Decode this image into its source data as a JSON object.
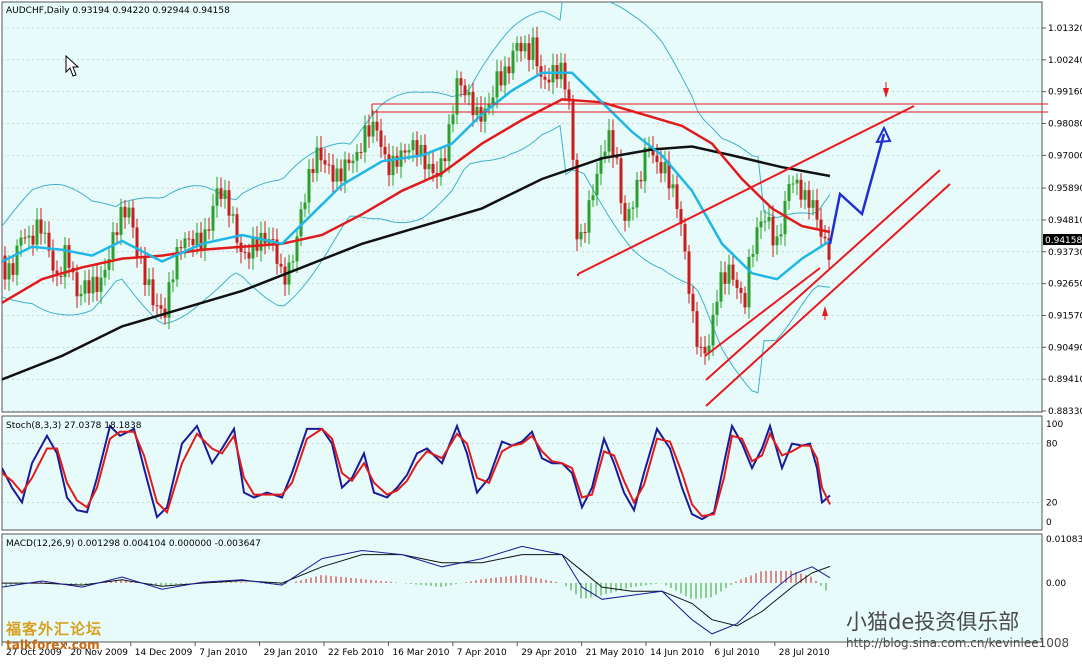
{
  "colors": {
    "panel_bg": "#e8fbfb",
    "grid": "#b0bcbc",
    "bull": "#2ca02c",
    "bear": "#c81e1e",
    "ma_fast": "#1fb7e6",
    "ma_mid": "#e01b1b",
    "ma_slow": "#111111",
    "bollinger": "#3fb2c8",
    "trend": "#e8191f",
    "projection": "#1f2fd0",
    "stoch_main": "#1a1a9a",
    "stoch_signal": "#e01b1b",
    "macd_main": "#1a1a9a",
    "macd_signal": "#111111"
  },
  "header": {
    "title": "AUDCHF,Daily  0.93194 0.94220 0.92944 0.94158"
  },
  "price_axis": {
    "ticks": [
      "1.01320",
      "1.00240",
      "0.99160",
      "0.98080",
      "0.97000",
      "0.95890",
      "0.94810",
      "0.93730",
      "0.92650",
      "0.91570",
      "0.90490",
      "0.89410",
      "0.88330"
    ],
    "current": "0.94158"
  },
  "stoch_panel": {
    "label": "Stoch(8,3,3) 27.0378 18.1838",
    "ticks": [
      "100",
      "80",
      "20",
      "0"
    ]
  },
  "macd_panel": {
    "label": "MACD(12,26,9) 0.001298 0.004104 0.000000 -0.003647",
    "ticks": [
      "0.01083",
      "0.00"
    ]
  },
  "date_axis": {
    "ticks": [
      "27 Oct 2009",
      "20 Nov 2009",
      "14 Dec 2009",
      "7 Jan 2010",
      "29 Jan 2010",
      "22 Feb 2010",
      "16 Mar 2010",
      "7 Apr 2010",
      "29 Apr 2010",
      "21 May 2010",
      "14 Jun 2010",
      "6 Jul 2010",
      "28 Jul 2010"
    ]
  },
  "watermarks": {
    "site_cn": "福客外汇论坛",
    "site_en": "talkforex.com",
    "club_cn": "小猫de投资俱乐部",
    "blog_url": "http://blog.sina.com.cn/kevinlee1008"
  },
  "chart_data": {
    "type": "candlestick",
    "symbol": "AUDCHF",
    "timeframe": "Daily",
    "last_ohlc": {
      "open": 0.93194,
      "high": 0.9422,
      "low": 0.92944,
      "close": 0.94158
    },
    "ylim": [
      0.8833,
      1.0132
    ],
    "close_path": [
      [
        0,
        0.936
      ],
      [
        10,
        0.932
      ],
      [
        20,
        0.94
      ],
      [
        28,
        0.936
      ],
      [
        38,
        0.948
      ],
      [
        46,
        0.944
      ],
      [
        55,
        0.93
      ],
      [
        64,
        0.936
      ],
      [
        75,
        0.918
      ],
      [
        88,
        0.928
      ],
      [
        100,
        0.932
      ],
      [
        110,
        0.94
      ],
      [
        120,
        0.946
      ],
      [
        128,
        0.948
      ],
      [
        135,
        0.938
      ],
      [
        145,
        0.932
      ],
      [
        155,
        0.92
      ],
      [
        163,
        0.914
      ],
      [
        172,
        0.928
      ],
      [
        180,
        0.94
      ],
      [
        192,
        0.946
      ],
      [
        205,
        0.944
      ],
      [
        215,
        0.954
      ],
      [
        228,
        0.95
      ],
      [
        240,
        0.94
      ],
      [
        252,
        0.942
      ],
      [
        262,
        0.938
      ],
      [
        272,
        0.936
      ],
      [
        280,
        0.928
      ],
      [
        290,
        0.938
      ],
      [
        298,
        0.952
      ],
      [
        306,
        0.96
      ],
      [
        315,
        0.966
      ],
      [
        325,
        0.964
      ],
      [
        335,
        0.966
      ],
      [
        345,
        0.972
      ],
      [
        355,
        0.968
      ],
      [
        365,
        0.974
      ],
      [
        375,
        0.978
      ],
      [
        385,
        0.97
      ],
      [
        395,
        0.972
      ],
      [
        405,
        0.97
      ],
      [
        415,
        0.968
      ],
      [
        425,
        0.966
      ],
      [
        435,
        0.968
      ],
      [
        445,
        0.976
      ],
      [
        455,
        0.992
      ],
      [
        465,
        0.986
      ],
      [
        475,
        0.984
      ],
      [
        485,
        0.99
      ],
      [
        495,
        0.998
      ],
      [
        505,
        0.994
      ],
      [
        515,
        1.004
      ],
      [
        525,
        1.006
      ],
      [
        532,
        1.012
      ],
      [
        540,
        0.998
      ],
      [
        550,
        0.996
      ],
      [
        560,
        0.994
      ],
      [
        568,
        0.984
      ],
      [
        576,
        0.94
      ],
      [
        582,
        0.95
      ],
      [
        590,
        0.96
      ],
      [
        598,
        0.966
      ],
      [
        606,
        0.972
      ],
      [
        614,
        0.966
      ],
      [
        622,
        0.948
      ],
      [
        630,
        0.958
      ],
      [
        638,
        0.966
      ],
      [
        646,
        0.974
      ],
      [
        654,
        0.962
      ],
      [
        662,
        0.962
      ],
      [
        670,
        0.96
      ],
      [
        678,
        0.954
      ],
      [
        686,
        0.932
      ],
      [
        692,
        0.912
      ],
      [
        700,
        0.898
      ],
      [
        708,
        0.902
      ],
      [
        714,
        0.92
      ],
      [
        720,
        0.93
      ],
      [
        728,
        0.936
      ],
      [
        736,
        0.928
      ],
      [
        742,
        0.918
      ],
      [
        748,
        0.932
      ],
      [
        754,
        0.938
      ],
      [
        760,
        0.946
      ],
      [
        768,
        0.948
      ],
      [
        774,
        0.942
      ],
      [
        780,
        0.952
      ],
      [
        788,
        0.964
      ],
      [
        796,
        0.956
      ],
      [
        804,
        0.95
      ],
      [
        810,
        0.952
      ],
      [
        816,
        0.948
      ],
      [
        822,
        0.944
      ],
      [
        828,
        0.94158
      ]
    ],
    "ma_fast": [
      [
        0,
        0.934
      ],
      [
        30,
        0.939
      ],
      [
        60,
        0.938
      ],
      [
        90,
        0.936
      ],
      [
        120,
        0.941
      ],
      [
        160,
        0.934
      ],
      [
        200,
        0.94
      ],
      [
        240,
        0.943
      ],
      [
        280,
        0.94
      ],
      [
        310,
        0.95
      ],
      [
        340,
        0.96
      ],
      [
        380,
        0.968
      ],
      [
        420,
        0.97
      ],
      [
        450,
        0.974
      ],
      [
        480,
        0.984
      ],
      [
        510,
        0.992
      ],
      [
        540,
        0.998
      ],
      [
        570,
        0.998
      ],
      [
        600,
        0.988
      ],
      [
        630,
        0.978
      ],
      [
        660,
        0.97
      ],
      [
        690,
        0.958
      ],
      [
        720,
        0.94
      ],
      [
        750,
        0.93
      ],
      [
        775,
        0.928
      ],
      [
        800,
        0.935
      ],
      [
        828,
        0.941
      ]
    ],
    "ma_mid": [
      [
        0,
        0.92
      ],
      [
        40,
        0.928
      ],
      [
        80,
        0.932
      ],
      [
        120,
        0.935
      ],
      [
        160,
        0.936
      ],
      [
        200,
        0.938
      ],
      [
        240,
        0.939
      ],
      [
        280,
        0.94
      ],
      [
        320,
        0.943
      ],
      [
        360,
        0.95
      ],
      [
        400,
        0.958
      ],
      [
        440,
        0.964
      ],
      [
        480,
        0.974
      ],
      [
        520,
        0.982
      ],
      [
        560,
        0.989
      ],
      [
        600,
        0.988
      ],
      [
        640,
        0.984
      ],
      [
        680,
        0.98
      ],
      [
        710,
        0.974
      ],
      [
        740,
        0.962
      ],
      [
        770,
        0.952
      ],
      [
        800,
        0.946
      ],
      [
        828,
        0.944
      ]
    ],
    "ma_slow": [
      [
        0,
        0.894
      ],
      [
        60,
        0.902
      ],
      [
        120,
        0.912
      ],
      [
        180,
        0.918
      ],
      [
        240,
        0.924
      ],
      [
        300,
        0.932
      ],
      [
        360,
        0.94
      ],
      [
        420,
        0.946
      ],
      [
        480,
        0.952
      ],
      [
        540,
        0.962
      ],
      [
        600,
        0.969
      ],
      [
        650,
        0.972
      ],
      [
        690,
        0.973
      ],
      [
        730,
        0.97
      ],
      [
        780,
        0.966
      ],
      [
        828,
        0.963
      ]
    ],
    "stochastic": {
      "main": [
        [
          0,
          55
        ],
        [
          10,
          35
        ],
        [
          20,
          20
        ],
        [
          30,
          60
        ],
        [
          45,
          88
        ],
        [
          55,
          70
        ],
        [
          65,
          25
        ],
        [
          75,
          12
        ],
        [
          85,
          10
        ],
        [
          95,
          45
        ],
        [
          108,
          98
        ],
        [
          118,
          88
        ],
        [
          132,
          95
        ],
        [
          142,
          55
        ],
        [
          155,
          5
        ],
        [
          165,
          15
        ],
        [
          180,
          80
        ],
        [
          195,
          98
        ],
        [
          210,
          60
        ],
        [
          220,
          75
        ],
        [
          232,
          95
        ],
        [
          242,
          30
        ],
        [
          252,
          25
        ],
        [
          265,
          30
        ],
        [
          280,
          25
        ],
        [
          290,
          50
        ],
        [
          305,
          95
        ],
        [
          320,
          95
        ],
        [
          330,
          80
        ],
        [
          340,
          35
        ],
        [
          350,
          45
        ],
        [
          362,
          70
        ],
        [
          372,
          30
        ],
        [
          385,
          25
        ],
        [
          395,
          35
        ],
        [
          405,
          48
        ],
        [
          415,
          70
        ],
        [
          425,
          75
        ],
        [
          440,
          60
        ],
        [
          455,
          98
        ],
        [
          465,
          70
        ],
        [
          475,
          30
        ],
        [
          487,
          45
        ],
        [
          500,
          82
        ],
        [
          510,
          78
        ],
        [
          520,
          82
        ],
        [
          530,
          92
        ],
        [
          540,
          65
        ],
        [
          550,
          60
        ],
        [
          560,
          60
        ],
        [
          570,
          50
        ],
        [
          580,
          15
        ],
        [
          590,
          35
        ],
        [
          602,
          85
        ],
        [
          612,
          60
        ],
        [
          622,
          30
        ],
        [
          632,
          12
        ],
        [
          642,
          50
        ],
        [
          655,
          95
        ],
        [
          668,
          75
        ],
        [
          680,
          35
        ],
        [
          690,
          8
        ],
        [
          700,
          3
        ],
        [
          712,
          10
        ],
        [
          722,
          60
        ],
        [
          730,
          98
        ],
        [
          740,
          80
        ],
        [
          750,
          55
        ],
        [
          760,
          75
        ],
        [
          768,
          98
        ],
        [
          780,
          55
        ],
        [
          790,
          80
        ],
        [
          800,
          78
        ],
        [
          808,
          80
        ],
        [
          815,
          55
        ],
        [
          820,
          20
        ],
        [
          828,
          27
        ]
      ],
      "signal": [
        [
          0,
          50
        ],
        [
          10,
          42
        ],
        [
          20,
          30
        ],
        [
          30,
          45
        ],
        [
          45,
          75
        ],
        [
          55,
          75
        ],
        [
          65,
          40
        ],
        [
          75,
          22
        ],
        [
          85,
          15
        ],
        [
          95,
          35
        ],
        [
          108,
          85
        ],
        [
          118,
          92
        ],
        [
          132,
          92
        ],
        [
          142,
          68
        ],
        [
          155,
          20
        ],
        [
          165,
          10
        ],
        [
          180,
          60
        ],
        [
          195,
          90
        ],
        [
          210,
          75
        ],
        [
          220,
          70
        ],
        [
          232,
          88
        ],
        [
          242,
          45
        ],
        [
          252,
          28
        ],
        [
          265,
          28
        ],
        [
          280,
          28
        ],
        [
          290,
          40
        ],
        [
          305,
          85
        ],
        [
          320,
          95
        ],
        [
          330,
          85
        ],
        [
          340,
          50
        ],
        [
          350,
          42
        ],
        [
          362,
          60
        ],
        [
          372,
          40
        ],
        [
          385,
          28
        ],
        [
          395,
          32
        ],
        [
          405,
          42
        ],
        [
          415,
          60
        ],
        [
          425,
          72
        ],
        [
          440,
          65
        ],
        [
          455,
          90
        ],
        [
          465,
          80
        ],
        [
          475,
          45
        ],
        [
          487,
          40
        ],
        [
          500,
          72
        ],
        [
          510,
          78
        ],
        [
          520,
          80
        ],
        [
          530,
          88
        ],
        [
          540,
          72
        ],
        [
          550,
          62
        ],
        [
          560,
          60
        ],
        [
          570,
          55
        ],
        [
          580,
          25
        ],
        [
          590,
          28
        ],
        [
          602,
          72
        ],
        [
          612,
          68
        ],
        [
          622,
          42
        ],
        [
          632,
          20
        ],
        [
          642,
          38
        ],
        [
          655,
          85
        ],
        [
          668,
          82
        ],
        [
          680,
          50
        ],
        [
          690,
          18
        ],
        [
          700,
          6
        ],
        [
          712,
          8
        ],
        [
          722,
          45
        ],
        [
          730,
          88
        ],
        [
          740,
          85
        ],
        [
          750,
          62
        ],
        [
          760,
          68
        ],
        [
          768,
          90
        ],
        [
          780,
          68
        ],
        [
          790,
          72
        ],
        [
          800,
          78
        ],
        [
          808,
          78
        ],
        [
          815,
          65
        ],
        [
          820,
          35
        ],
        [
          828,
          18
        ]
      ],
      "levels": [
        100,
        80,
        20,
        0
      ]
    },
    "macd": {
      "main": [
        [
          0,
          -0.001
        ],
        [
          40,
          0.0005
        ],
        [
          80,
          -0.001
        ],
        [
          120,
          0.0015
        ],
        [
          160,
          -0.0015
        ],
        [
          200,
          0.0002
        ],
        [
          240,
          0.0008
        ],
        [
          280,
          -0.0005
        ],
        [
          320,
          0.006
        ],
        [
          360,
          0.008
        ],
        [
          400,
          0.007
        ],
        [
          440,
          0.004
        ],
        [
          480,
          0.006
        ],
        [
          520,
          0.009
        ],
        [
          560,
          0.007
        ],
        [
          580,
          -0.001
        ],
        [
          600,
          -0.004
        ],
        [
          630,
          -0.003
        ],
        [
          660,
          -0.002
        ],
        [
          690,
          -0.009
        ],
        [
          710,
          -0.0125
        ],
        [
          735,
          -0.01
        ],
        [
          760,
          -0.004
        ],
        [
          790,
          0.002
        ],
        [
          810,
          0.004
        ],
        [
          828,
          0.0013
        ]
      ],
      "signal": [
        [
          0,
          0.0
        ],
        [
          40,
          0.0
        ],
        [
          80,
          -0.0005
        ],
        [
          120,
          0.0008
        ],
        [
          160,
          -0.0008
        ],
        [
          200,
          0.0
        ],
        [
          240,
          0.0006
        ],
        [
          280,
          0.0
        ],
        [
          320,
          0.004
        ],
        [
          360,
          0.007
        ],
        [
          400,
          0.007
        ],
        [
          440,
          0.005
        ],
        [
          480,
          0.005
        ],
        [
          520,
          0.007
        ],
        [
          560,
          0.007
        ],
        [
          580,
          0.003
        ],
        [
          600,
          -0.001
        ],
        [
          630,
          -0.002
        ],
        [
          660,
          -0.002
        ],
        [
          690,
          -0.005
        ],
        [
          710,
          -0.009
        ],
        [
          735,
          -0.0105
        ],
        [
          760,
          -0.007
        ],
        [
          790,
          -0.001
        ],
        [
          810,
          0.0025
        ],
        [
          828,
          0.0041
        ]
      ],
      "hist_zero": 0.0,
      "ylim": [
        -0.014,
        0.01083
      ]
    }
  }
}
